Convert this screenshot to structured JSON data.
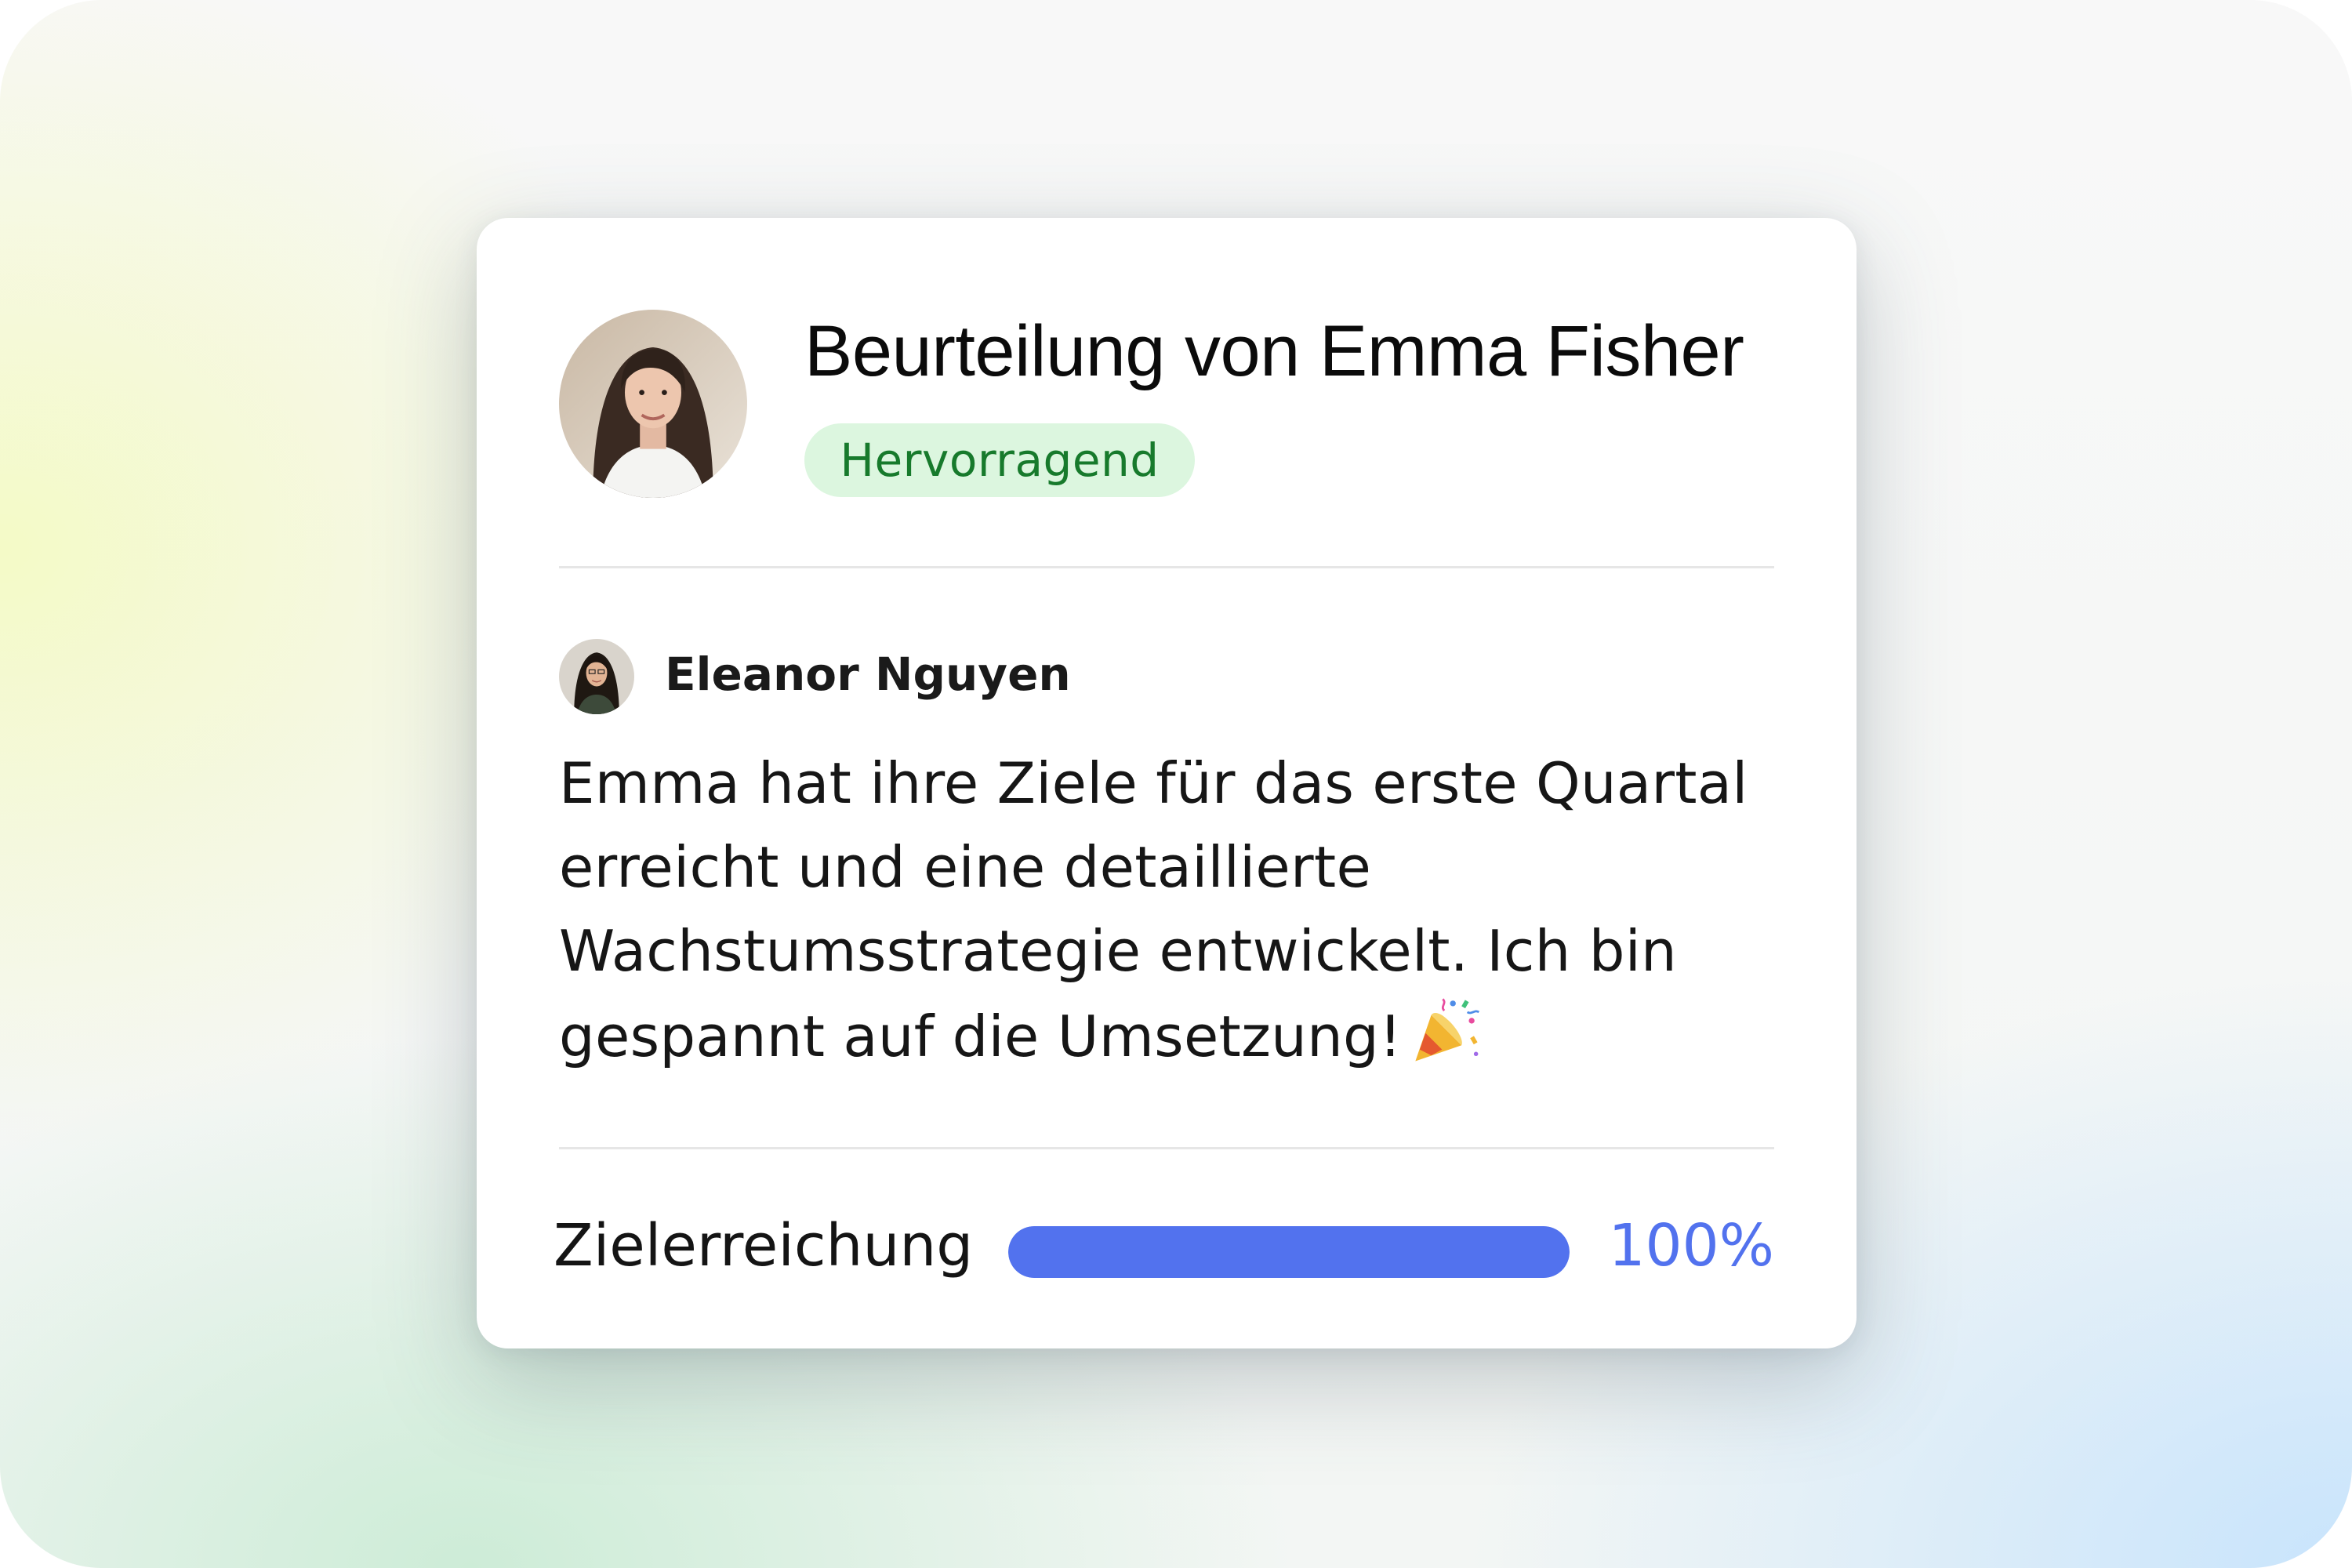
{
  "review": {
    "title": "Beurteilung von Emma Fisher",
    "rating_badge": "Hervorragend",
    "subject_avatar_icon": "person-photo-emma-fisher",
    "badge_color": "#dcf6df",
    "badge_text_color": "#177a2c"
  },
  "comment": {
    "author": "Eleanor Nguyen",
    "author_avatar_icon": "person-photo-eleanor-nguyen",
    "text": "Emma hat ihre Ziele für das erste Quartal erreicht und eine detaillierte Wachstumsstrategie entwickelt. Ich bin gespannt auf die Umsetzung!",
    "emoji_icon": "party-popper-icon"
  },
  "goal_progress": {
    "label": "Zielerreichung",
    "value_text": "100%",
    "fraction": 1.0,
    "accent_color": "#5272ee"
  }
}
